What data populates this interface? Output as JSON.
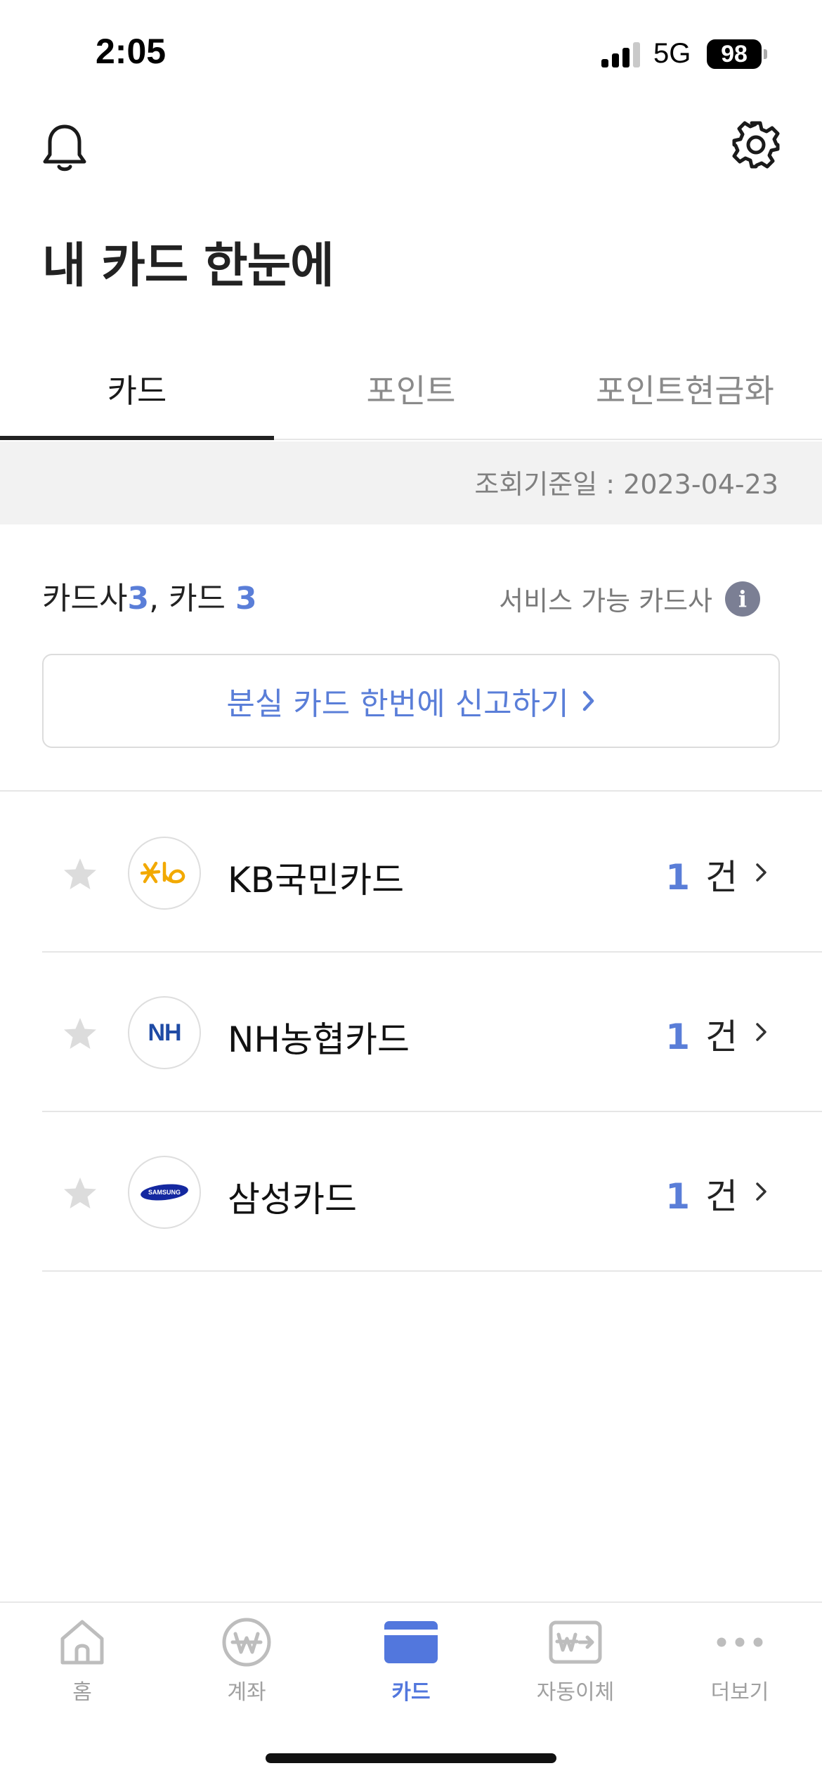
{
  "status_bar": {
    "time": "2:05",
    "network": "5G",
    "battery": "98"
  },
  "header": {
    "title": "내 카드 한눈에",
    "icons": [
      "bell-icon",
      "gear-icon"
    ]
  },
  "tabs": [
    {
      "label": "카드",
      "active": true
    },
    {
      "label": "포인트",
      "active": false
    },
    {
      "label": "포인트현금화",
      "active": false
    }
  ],
  "date_bar": {
    "text": "조회기준일 : 2023-04-23"
  },
  "summary": {
    "issuer_label": "카드사",
    "issuer_count": "3",
    "separator": ",",
    "card_label": "카드",
    "card_count": "3",
    "service_link": "서비스 가능 카드사",
    "info_icon": "i"
  },
  "report_button": {
    "label": "분실 카드 한번에 신고하기",
    "chevron": "›"
  },
  "cards": [
    {
      "name": "KB국민카드",
      "count": "1",
      "unit": "건",
      "logo": "kb-logo",
      "logo_color": "#f2a900"
    },
    {
      "name": "NH농협카드",
      "count": "1",
      "unit": "건",
      "logo": "nh-logo",
      "logo_text": "NH",
      "logo_color": "#1f4ba5"
    },
    {
      "name": "삼성카드",
      "count": "1",
      "unit": "건",
      "logo": "samsung-logo",
      "logo_text": "SAMSUNG",
      "logo_color": "#1428a0"
    }
  ],
  "bottom_nav": [
    {
      "label": "홈",
      "icon": "home-icon",
      "active": false
    },
    {
      "label": "계좌",
      "icon": "won-coin-icon",
      "active": false
    },
    {
      "label": "카드",
      "icon": "card-icon",
      "active": true
    },
    {
      "label": "자동이체",
      "icon": "auto-transfer-icon",
      "active": false
    },
    {
      "label": "더보기",
      "icon": "more-dots-icon",
      "active": false
    }
  ],
  "colors": {
    "accent": "#5a7ed8",
    "nav_active": "#5277dd",
    "tab_indicator": "#222222",
    "date_bar_bg": "#f2f2f2"
  }
}
